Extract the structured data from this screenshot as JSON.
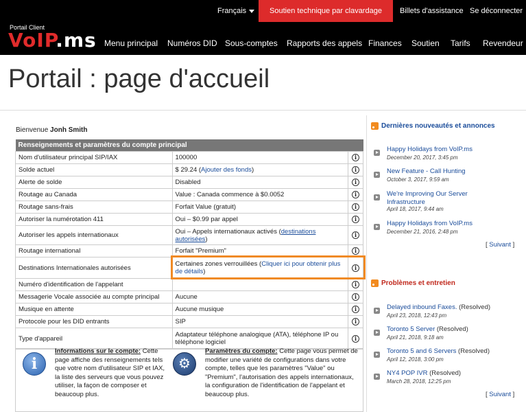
{
  "topbar": {
    "language": "Français",
    "chat": "Soutien technique par clavardage",
    "tickets": "Billets d'assistance",
    "logout": "Se déconnecter"
  },
  "brand": {
    "subtitle": "Portail Client",
    "logo_red": "VoIP",
    "logo_white": ".ms"
  },
  "nav": [
    "Menu principal",
    "Numéros DID",
    "Sous-comptes",
    "Rapports des appels",
    "Finances",
    "Soutien",
    "Tarifs",
    "Revendeur"
  ],
  "page_title": "Portail : page d'accueil",
  "welcome": {
    "prefix": "Bienvenue",
    "name": "Jonh Smith"
  },
  "table": {
    "header": "Renseignements et paramètres du compte principal",
    "rows": [
      {
        "label": "Nom d'utilisateur principal SIP/IAX",
        "value": "100000"
      },
      {
        "label": "Solde actuel",
        "value": "$ 29.24 (",
        "link": "Ajouter des fonds",
        "suffix": ")"
      },
      {
        "label": "Alerte de solde",
        "value": "Disabled"
      },
      {
        "label": "Routage au Canada",
        "value": "Value : Canada commence à $0.0052"
      },
      {
        "label": "Routage sans-frais",
        "value": "Forfait Value (gratuit)"
      },
      {
        "label": "Autoriser la numérotation 411",
        "value": "Oui – $0.99 par appel"
      },
      {
        "label": "Autoriser les appels internationaux",
        "value": "Oui – Appels internationaux activés (",
        "link": "destinations autorisées",
        "suffix": ")"
      },
      {
        "label": "Routage international",
        "value": "Forfait \"Premium\""
      },
      {
        "label": "Destinations Internationales autorisées",
        "value": "Certaines zones verrouillées (",
        "link": "Cliquer ici pour obtenir plus de détails",
        "suffix": ")"
      },
      {
        "label": "Numéro d'identification de l'appelant",
        "value": ""
      },
      {
        "label": "Messagerie Vocale associée au compte principal",
        "value": "Aucune"
      },
      {
        "label": "Musique en attente",
        "value": "Aucune musique"
      },
      {
        "label": "Protocole pour les DID entrants",
        "value": "SIP"
      },
      {
        "label": "Type d'appareil",
        "value": "Adaptateur téléphone analogique (ATA), téléphone IP ou téléphone logiciel"
      }
    ]
  },
  "info_boxes": [
    {
      "title": "Informations sur le compte:",
      "text": "Cette page affiche des renseignements tels que votre nom d'utilisateur SIP et IAX, la liste des serveurs que vous pouvez utiliser, la façon de composer et beaucoup plus.",
      "icon": "info-icon"
    },
    {
      "title": "Paramètres du compte:",
      "text": "Cette page vous permet de modifier une variété de configurations dans votre compte, telles que les paramètres \"Value\" ou \"Premium\", l'autorisation des appels internationaux, la configuration de l'identification de l'appelant et beaucoup plus.",
      "icon": "gear-icon"
    }
  ],
  "news": {
    "heading": "Dernières nouveautés et annonces",
    "items": [
      {
        "title": "Happy Holidays from VoIP.ms",
        "date": "December 20, 2017, 3:45 pm"
      },
      {
        "title": "New Feature - Call Hunting",
        "date": "October 3, 2017, 9:59 am"
      },
      {
        "title": "We're Improving Our Server Infrastructure",
        "date": "April 18, 2017, 9:44 am"
      },
      {
        "title": "Happy Holidays from VoIP.ms",
        "date": "December 21, 2016, 2:48 pm"
      }
    ],
    "next": "Suivant"
  },
  "issues": {
    "heading": "Problèmes et entretien",
    "items": [
      {
        "title": "Delayed inbound Faxes.",
        "status": "(Resolved)",
        "date": "April 23, 2018, 12:43 pm"
      },
      {
        "title": "Toronto 5 Server",
        "status": "(Resolved)",
        "date": "April 21, 2018, 9:18 am"
      },
      {
        "title": "Toronto 5 and 6 Servers",
        "status": "(Resolved)",
        "date": "April 12, 2018, 3:00 pm"
      },
      {
        "title": "NY4 POP IVR",
        "status": "(Resolved)",
        "date": "March 28, 2018, 12:25 pm"
      }
    ],
    "next": "Suivant"
  },
  "colors": {
    "brand_red": "#e02b2b",
    "chat_bg": "#dd2b2b",
    "link": "#1a4c9a",
    "highlight": "#f08a24"
  }
}
